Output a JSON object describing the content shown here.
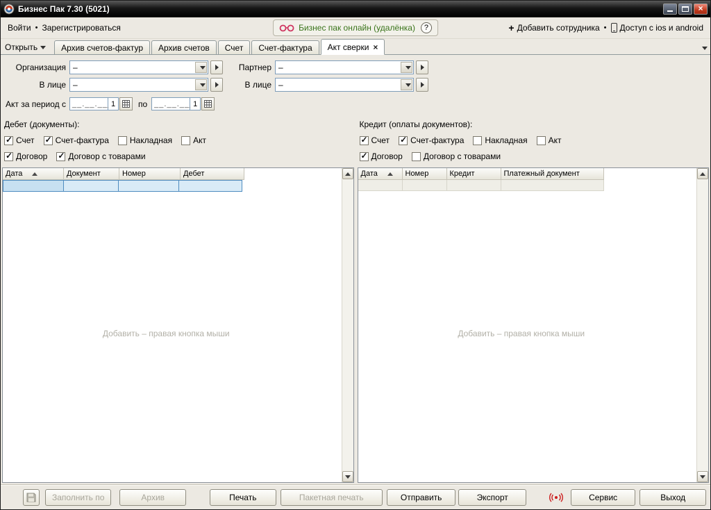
{
  "colors": {
    "online_link": "#39741a",
    "signal_icon": "#cc1f1f",
    "selected_row": "#d9ebf7"
  },
  "window": {
    "title": "Бизнес Пак 7.30 (5021)"
  },
  "toolbar": {
    "login": "Войти",
    "separator": "•",
    "register": "Зарегистрироваться",
    "online_link": "Бизнес пак онлайн (удалёнка)",
    "help": "?",
    "add_employee": "Добавить сотрудника",
    "access": "Доступ с ios и android"
  },
  "tab_bar": {
    "open_button": "Открыть",
    "tabs": [
      {
        "label": "Архив счетов-фактур",
        "active": false
      },
      {
        "label": "Архив счетов",
        "active": false
      },
      {
        "label": "Счет",
        "active": false
      },
      {
        "label": "Счет-фактура",
        "active": false
      },
      {
        "label": "Акт сверки",
        "active": true,
        "close": "×"
      }
    ]
  },
  "form": {
    "organization": {
      "label": "Организация",
      "value": "–"
    },
    "partner": {
      "label": "Партнер",
      "value": "–"
    },
    "org_person": {
      "label": "В лице",
      "value": "–"
    },
    "partner_person": {
      "label": "В лице",
      "value": "–"
    },
    "period": {
      "label": "Акт за период с",
      "to_label": "по",
      "from_value": "__.__.____",
      "from_day": "1",
      "to_value": "__.__.____",
      "to_day": "1"
    }
  },
  "debit": {
    "title": "Дебет (документы):",
    "checks": [
      {
        "label": "Счет",
        "checked": true
      },
      {
        "label": "Счет-фактура",
        "checked": true
      },
      {
        "label": "Накладная",
        "checked": false
      },
      {
        "label": "Акт",
        "checked": false
      },
      {
        "label": "Договор",
        "checked": true
      },
      {
        "label": "Договор с товарами",
        "checked": true
      }
    ],
    "columns": [
      "Дата",
      "Документ",
      "Номер",
      "Дебет"
    ],
    "empty_hint": "Добавить – правая кнопка мыши"
  },
  "credit": {
    "title": "Кредит (оплаты документов):",
    "checks": [
      {
        "label": "Счет",
        "checked": true
      },
      {
        "label": "Счет-фактура",
        "checked": true
      },
      {
        "label": "Накладная",
        "checked": false
      },
      {
        "label": "Акт",
        "checked": false
      },
      {
        "label": "Договор",
        "checked": true
      },
      {
        "label": "Договор с товарами",
        "checked": false
      }
    ],
    "columns": [
      "Дата",
      "Номер",
      "Кредит",
      "Платежный документ"
    ],
    "empty_hint": "Добавить – правая кнопка мыши"
  },
  "footer": {
    "buttons": [
      {
        "label": "Заполнить по",
        "enabled": false
      },
      {
        "label": "Архив",
        "enabled": false
      },
      {
        "label": "Печать",
        "enabled": true
      },
      {
        "label": "Пакетная печать",
        "enabled": false
      },
      {
        "label": "Отправить",
        "enabled": true
      },
      {
        "label": "Экспорт",
        "enabled": true
      },
      {
        "label": "Сервис",
        "enabled": true
      },
      {
        "label": "Выход",
        "enabled": true
      }
    ]
  }
}
